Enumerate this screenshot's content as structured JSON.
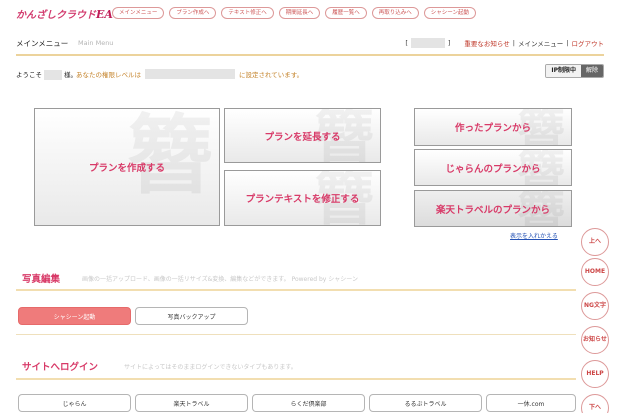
{
  "brand": {
    "logo_main": "かんざしクラウド",
    "logo_suffix": "EA"
  },
  "topnav": [
    "メインメニュー",
    "プラン作成へ",
    "テキスト修正へ",
    "期間延長へ",
    "履歴一覧へ",
    "再取り込みへ",
    "シャシーン起動"
  ],
  "header": {
    "title": "メインメニュー",
    "subtitle": "Main Menu",
    "bracket_open": "[",
    "bracket_close": "]",
    "notice": "重要なお知らせ",
    "sep": "|",
    "menu": "メインメニュー",
    "logout": "ログアウト"
  },
  "welcome": {
    "prefix": "ようこそ",
    "suffix": "様。",
    "level_prefix": "あなたの権限レベルは",
    "level_suffix": "に設定されています。"
  },
  "ip": {
    "label": "IP制限中",
    "action": "解除"
  },
  "actions": {
    "create": "プランを作成する",
    "extend": "プランを延長する",
    "modify": "プランテキストを修正する",
    "from_created": "作ったプランから",
    "from_jalan": "じゃらんのプランから",
    "from_rakuten": "楽天トラベルのプランから",
    "reorder": "表示を入れかえる"
  },
  "side": [
    "上へ",
    "HOME",
    "NG文字",
    "お知らせ",
    "HELP",
    "下へ"
  ],
  "photo": {
    "title": "写真編集",
    "desc": "画像の一括アップロード、画像の一括リサイズ&変換、編集などができます。 Powered by シャシーン",
    "btn_shasheen": "シャシーン起動",
    "btn_backup": "写真バックアップ"
  },
  "login": {
    "title": "サイトへログイン",
    "desc": "サイトによってはそのままログインできないタイプもあります。",
    "sites": [
      "じゃらん",
      "楽天トラベル",
      "らくだ倶楽部",
      "るるぶトラベル",
      "一休.com"
    ]
  }
}
